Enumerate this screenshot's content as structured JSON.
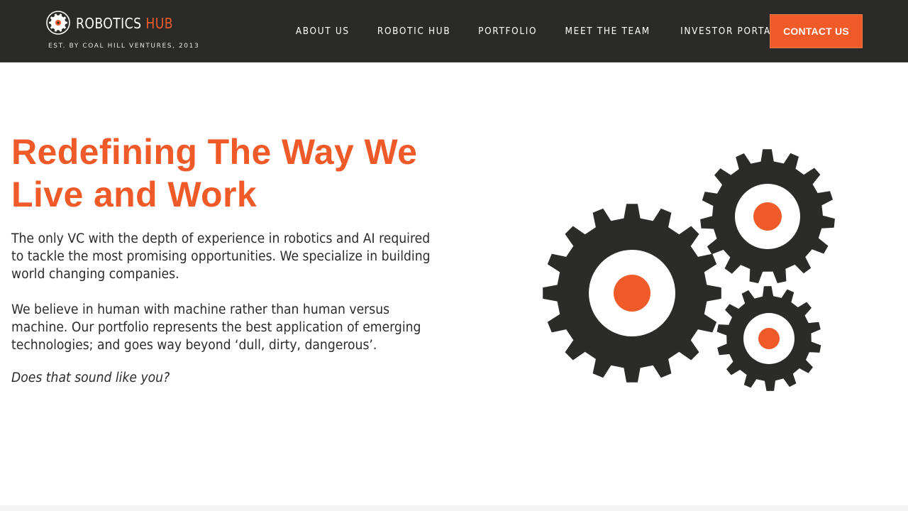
{
  "brand": {
    "name_primary": "ROBOTICS",
    "name_accent": "HUB",
    "tagline": "EST. BY COAL HILL VENTURES, 2013",
    "logo_icon": "gear-logo-icon"
  },
  "nav": {
    "items": [
      {
        "label": "ABOUT US"
      },
      {
        "label": "ROBOTIC HUB"
      },
      {
        "label": "PORTFOLIO"
      },
      {
        "label": "MEET THE TEAM"
      },
      {
        "label": "INVESTOR PORTAL"
      }
    ],
    "cta_label": "CONTACT US"
  },
  "hero": {
    "title": "Redefining The Way We Live and Work",
    "paragraph1": "The only VC with the depth of experience in robotics and AI required to tackle the most promising opportunities. We specialize in building world changing companies.",
    "paragraph2": "We believe in human with machine rather than human versus machine. Our portfolio represents the best application of emerging technologies; and goes way beyond ‘dull, dirty, dangerous’.",
    "question": "Does that sound like you?",
    "illustration_icon": "gears-illustration"
  },
  "colors": {
    "accent": "#f05a28",
    "header_bg": "#2a2a28",
    "gear": "#2b2b29",
    "text": "#2b2b2b"
  }
}
